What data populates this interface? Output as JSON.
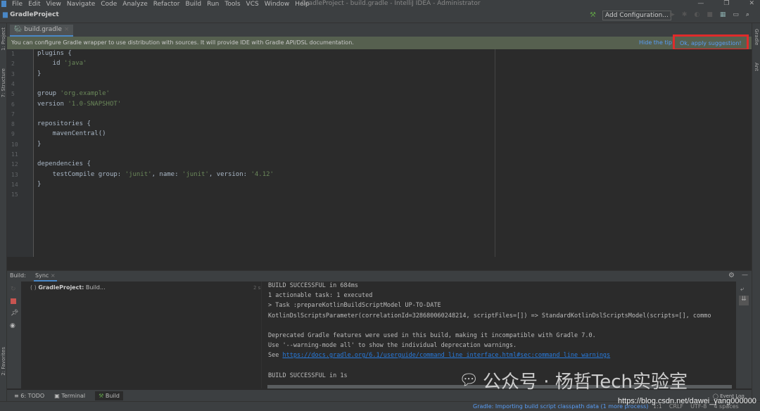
{
  "menu": [
    "File",
    "Edit",
    "View",
    "Navigate",
    "Code",
    "Analyze",
    "Refactor",
    "Build",
    "Run",
    "Tools",
    "VCS",
    "Window",
    "Help"
  ],
  "window_title": "GradleProject - build.gradle - IntelliJ IDEA - Administrator",
  "project_name": "GradleProject",
  "add_configuration": "Add Configuration...",
  "left_strip": {
    "project": "1: Project",
    "structure": "7: Structure",
    "favorites": "2: Favorites"
  },
  "right_strip": {
    "gradle": "Gradle",
    "ant": "Ant"
  },
  "editor_tab": "build.gradle",
  "tip": {
    "text": "You can configure Gradle wrapper to use distribution with sources. It will provide IDE with Gradle API/DSL documentation.",
    "hide": "Hide the tip",
    "apply": "Ok, apply suggestion!"
  },
  "code": [
    [
      {
        "t": "plugins {"
      }
    ],
    [
      {
        "t": "    id "
      },
      {
        "t": "'java'",
        "s": 1
      }
    ],
    [
      {
        "t": "}"
      }
    ],
    [
      {
        "t": ""
      }
    ],
    [
      {
        "t": "group "
      },
      {
        "t": "'org.example'",
        "s": 1
      }
    ],
    [
      {
        "t": "version "
      },
      {
        "t": "'1.0-SNAPSHOT'",
        "s": 1
      }
    ],
    [
      {
        "t": ""
      }
    ],
    [
      {
        "t": "repositories {"
      }
    ],
    [
      {
        "t": "    mavenCentral()"
      }
    ],
    [
      {
        "t": "}"
      }
    ],
    [
      {
        "t": ""
      }
    ],
    [
      {
        "t": "dependencies {"
      }
    ],
    [
      {
        "t": "    testCompile group: "
      },
      {
        "t": "'junit'",
        "s": 1
      },
      {
        "t": ", name: "
      },
      {
        "t": "'junit'",
        "s": 1
      },
      {
        "t": ", version: "
      },
      {
        "t": "'4.12'",
        "s": 1
      }
    ],
    [
      {
        "t": "}"
      }
    ],
    [
      {
        "t": ""
      }
    ]
  ],
  "build": {
    "label": "Build:",
    "tab": "Sync",
    "close": "×",
    "tree_item_bold": "GradleProject:",
    "tree_item": " Build...",
    "time": "2 s",
    "console": [
      "BUILD SUCCESSFUL in 684ms",
      "1 actionable task: 1 executed",
      "> Task :prepareKotlinBuildScriptModel UP-TO-DATE",
      "KotlinDslScriptsParameter(correlationId=328680060248214, scriptFiles=[]) => StandardKotlinDslScriptsModel(scripts=[], commo",
      "",
      "Deprecated Gradle features were used in this build, making it incompatible with Gradle 7.0.",
      "Use '--warning-mode all' to show the individual deprecation warnings.",
      "",
      "",
      "BUILD SUCCESSFUL in 1s"
    ],
    "see": "See ",
    "link": "https://docs.gradle.org/6.1/userguide/command_line_interface.html#sec:command_line_warnings"
  },
  "tool_tabs": [
    "6: TODO",
    "Terminal",
    "Build"
  ],
  "status": {
    "message": "Gradle: Importing build script classpath data (1 more process)",
    "position": "1:1",
    "line_sep": "CRLF",
    "encoding": "UTF-8",
    "indent": "4 spaces",
    "event_log": "Event Log"
  },
  "watermark": {
    "text": "公众号 · 杨哲Tech实验室",
    "url": "https://blog.csdn.net/dawei_yang000000"
  }
}
